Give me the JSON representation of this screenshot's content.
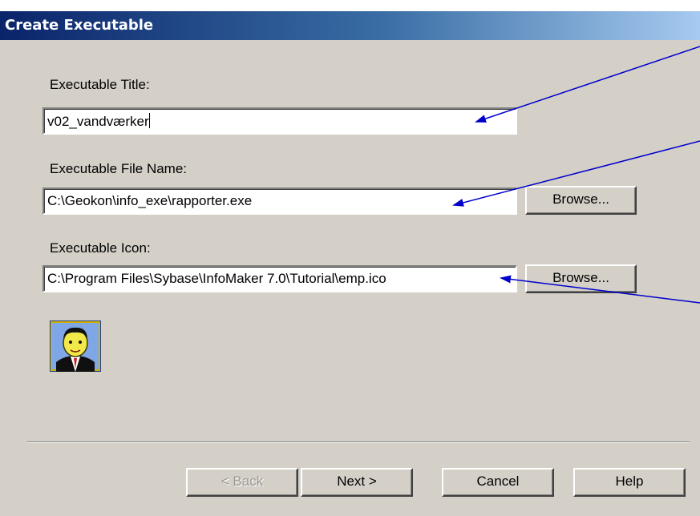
{
  "window": {
    "title": "Create Executable"
  },
  "form": {
    "title_label": "Executable Title:",
    "title_value": "v02_vandværker",
    "file_label": "Executable File Name:",
    "file_value": "C:\\Geokon\\info_exe\\rapporter.exe",
    "icon_label": "Executable Icon:",
    "icon_value": "C:\\Program Files\\Sybase\\InfoMaker 7.0\\Tutorial\\emp.ico",
    "browse_label": "Browse..."
  },
  "icon_preview": {
    "icon": "person-icon"
  },
  "buttons": {
    "back": "< Back",
    "next": "Next >",
    "cancel": "Cancel",
    "help": "Help"
  },
  "colors": {
    "titlebar_start": "#0a246a",
    "titlebar_end": "#a6caf0",
    "arrow": "#0000cc"
  }
}
